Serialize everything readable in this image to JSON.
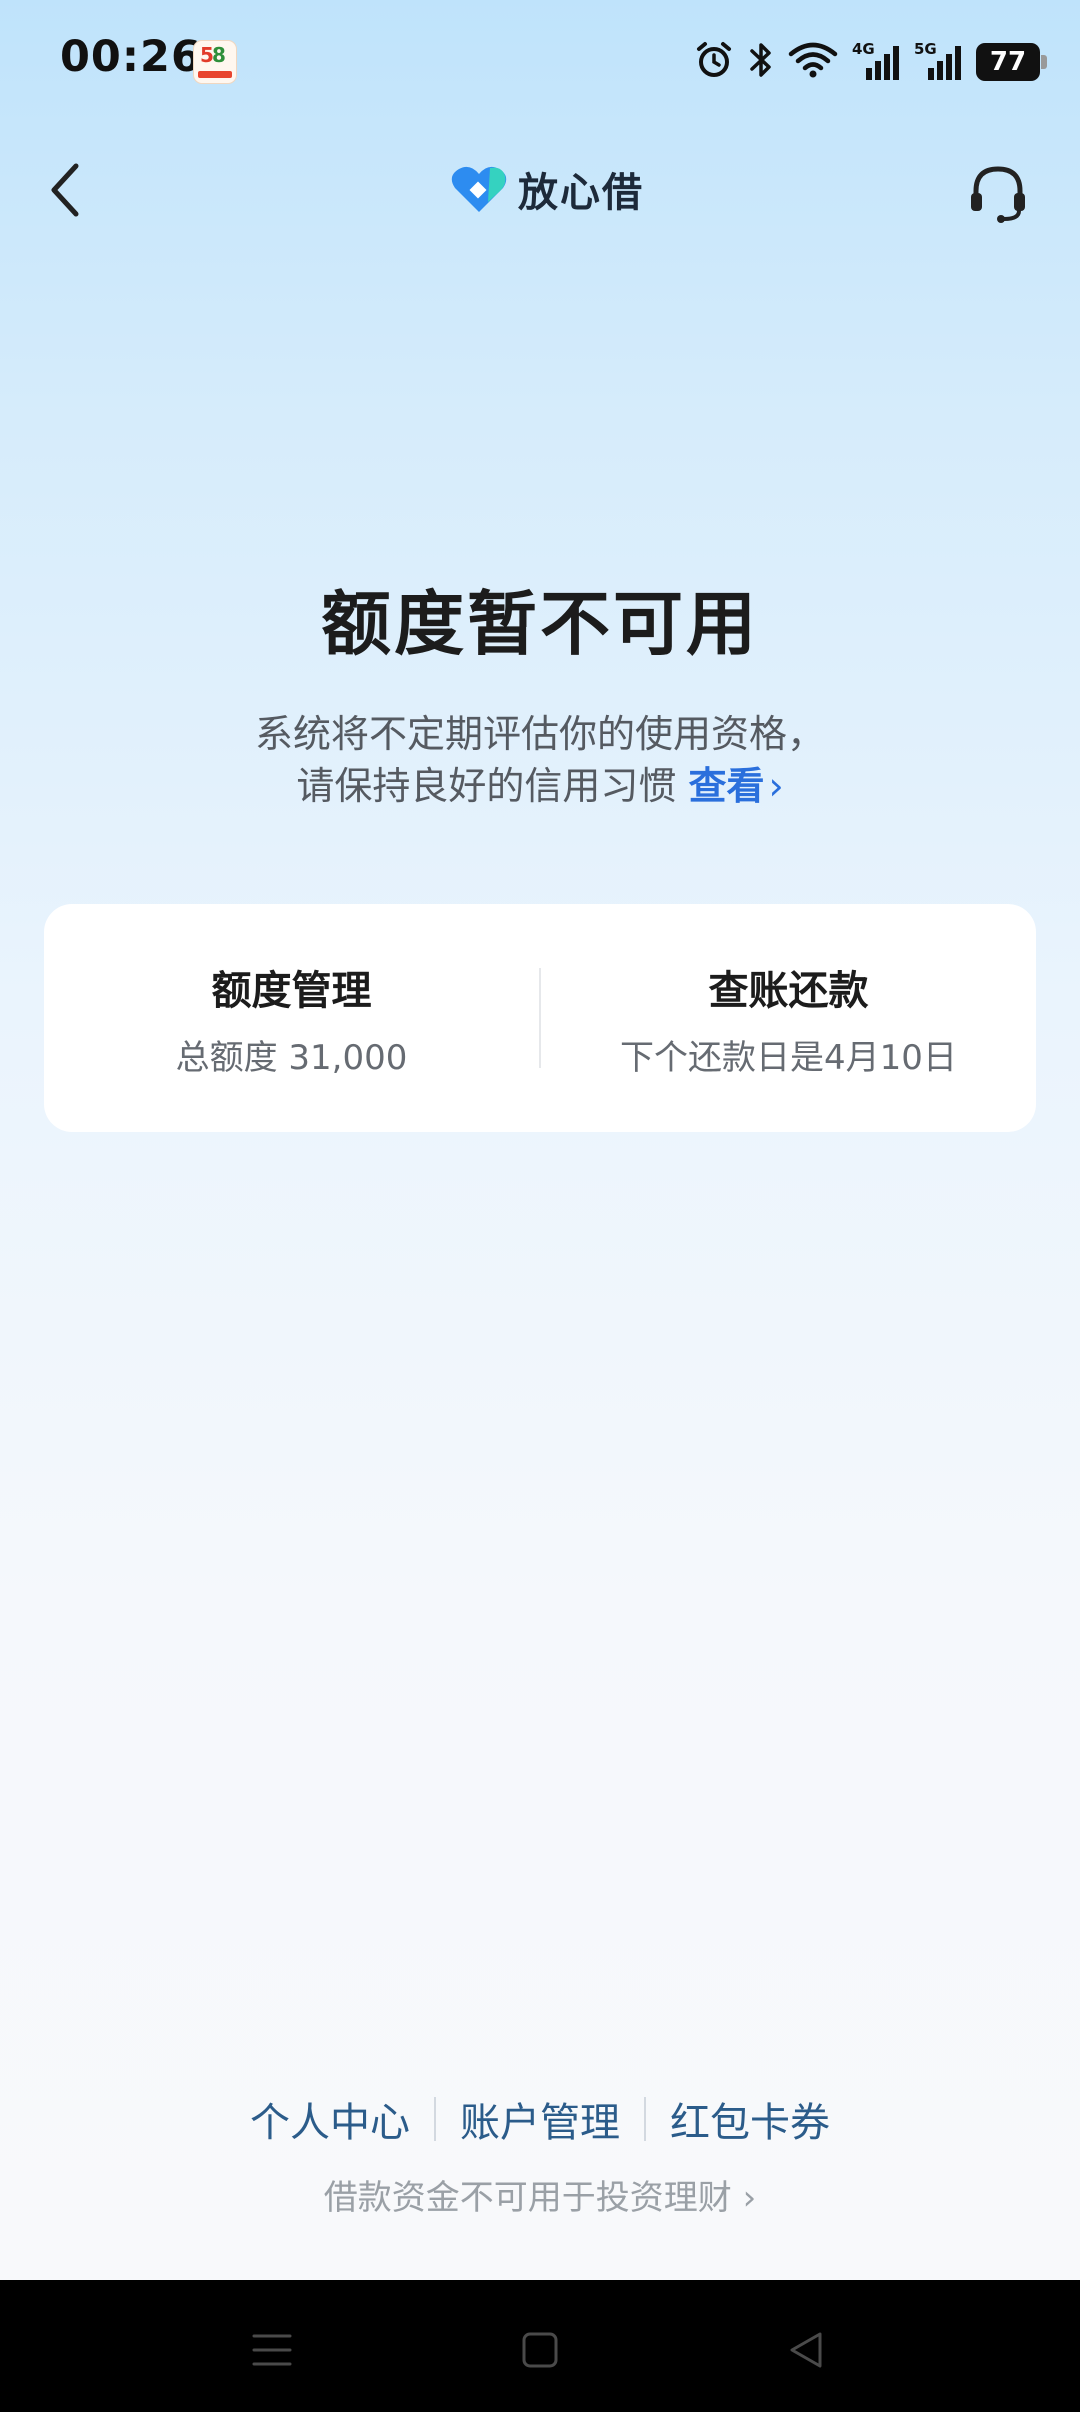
{
  "status_bar": {
    "time": "00:26",
    "app_badge": {
      "digit1": "5",
      "digit2": "8"
    },
    "battery": "77",
    "signal_1_label": "4G",
    "signal_2_label": "5G"
  },
  "header": {
    "app_name": "放心借",
    "brand_colors": {
      "blue": "#2d8cf0",
      "teal": "#35d2c0"
    }
  },
  "main": {
    "title": "额度暂不可用",
    "subtitle_line1": "系统将不定期评估你的使用资格，",
    "subtitle_line2": "请保持良好的信用习惯",
    "view_link": "查看",
    "view_link_chevron": "›"
  },
  "card": {
    "left": {
      "title": "额度管理",
      "subtitle": "总额度 31,000"
    },
    "right": {
      "title": "查账还款",
      "subtitle": "下个还款日是4月10日"
    }
  },
  "footer": {
    "links": [
      "个人中心",
      "账户管理",
      "红包卡券"
    ],
    "disclaimer": "借款资金不可用于投资理财 ›"
  },
  "icons": {
    "back": "back-chevron-icon",
    "support": "headset-icon",
    "alarm": "alarm-icon",
    "bluetooth": "bluetooth-icon",
    "wifi": "wifi-icon"
  },
  "colors": {
    "link_blue": "#2a6fdc",
    "footer_link": "#2b5c8a",
    "title": "#1c1c1c"
  }
}
